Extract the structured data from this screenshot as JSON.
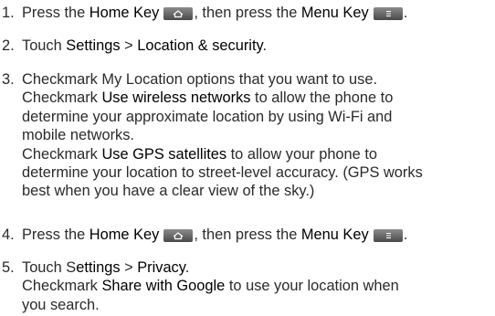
{
  "steps": [
    {
      "number": "1.",
      "lines": [
        [
          {
            "t": "Press the "
          },
          {
            "t": "Home Key",
            "b": true
          },
          {
            "icon": "home-key-icon"
          },
          {
            "t": ", then press the "
          },
          {
            "t": "Menu Key",
            "b": true
          },
          {
            "icon": "menu-key-icon"
          },
          {
            "t": "."
          }
        ]
      ]
    },
    {
      "number": "2.",
      "lines": [
        [
          {
            "t": "Touch "
          },
          {
            "t": "Settings",
            "b": true
          },
          {
            "t": " > "
          },
          {
            "t": "Location & security",
            "b": true
          },
          {
            "t": "."
          }
        ]
      ]
    },
    {
      "number": "3.",
      "lines": [
        [
          {
            "t": "Checkmark My Location options that you want to use."
          }
        ],
        [
          {
            "t": "Checkmark "
          },
          {
            "t": "Use wireless networks",
            "b": true
          },
          {
            "t": " to allow the phone to"
          }
        ],
        [
          {
            "t": "determine your approximate location by using Wi-Fi and"
          }
        ],
        [
          {
            "t": "mobile networks."
          }
        ],
        [
          {
            "t": "Checkmark "
          },
          {
            "t": "Use GPS satellites",
            "b": true
          },
          {
            "t": " to allow your phone to"
          }
        ],
        [
          {
            "t": "determine your location to street-level accuracy. (GPS works"
          }
        ],
        [
          {
            "t": "best when you have a clear view of the sky.)"
          }
        ]
      ]
    },
    {
      "number": "4.",
      "lines": [
        [
          {
            "t": "Press the "
          },
          {
            "t": "Home Key",
            "b": true
          },
          {
            "icon": "home-key-icon"
          },
          {
            "t": ", then press the "
          },
          {
            "t": "Menu Key",
            "b": true
          },
          {
            "icon": "menu-key-icon"
          },
          {
            "t": "."
          }
        ]
      ]
    },
    {
      "number": "5.",
      "lines": [
        [
          {
            "t": "Touch S"
          },
          {
            "t": "ettings",
            "b": true
          },
          {
            "t": " > "
          },
          {
            "t": "Privacy",
            "b": true
          },
          {
            "t": "."
          }
        ],
        [
          {
            "t": "Checkmark "
          },
          {
            "t": "Share with Google",
            "b": true
          },
          {
            "t": " to use your location when"
          }
        ],
        [
          {
            "t": "you search."
          }
        ]
      ]
    }
  ]
}
